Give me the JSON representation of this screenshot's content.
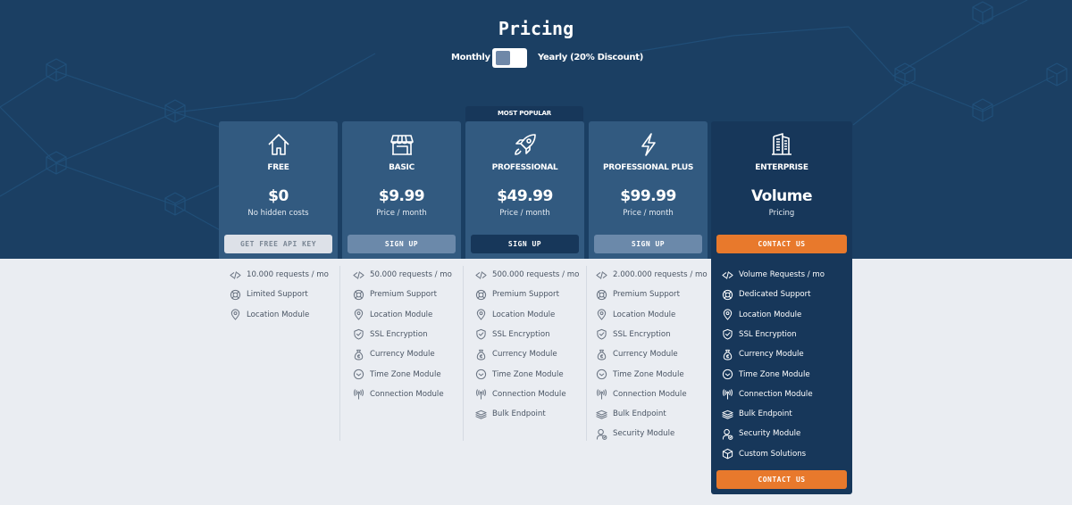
{
  "header": {
    "title": "Pricing",
    "toggle": {
      "left_label": "Monthly",
      "right_label": "Yearly  (20% Discount)",
      "selected": "Monthly"
    }
  },
  "badge": "MOST POPULAR",
  "colors": {
    "hero_bg": "#1b3f63",
    "card_bg": "#325a80",
    "enterprise_bg": "#17375a",
    "accent_orange": "#e8792c",
    "page_bg": "#eaedf2"
  },
  "plans": [
    {
      "name": "FREE",
      "icon": "house-icon",
      "price": "$0",
      "price_sub": "No hidden costs",
      "button": "GET FREE API KEY",
      "features": [
        {
          "icon": "code-icon",
          "label": "10.000 requests / mo"
        },
        {
          "icon": "lifebuoy-icon",
          "label": "Limited Support"
        },
        {
          "icon": "map-pin-icon",
          "label": "Location Module"
        }
      ]
    },
    {
      "name": "BASIC",
      "icon": "storefront-icon",
      "price": "$9.99",
      "price_sub": "Price / month",
      "button": "SIGN UP",
      "features": [
        {
          "icon": "code-icon",
          "label": "50.000 requests / mo"
        },
        {
          "icon": "lifebuoy-icon",
          "label": "Premium Support"
        },
        {
          "icon": "map-pin-icon",
          "label": "Location Module"
        },
        {
          "icon": "shield-check-icon",
          "label": "SSL Encryption"
        },
        {
          "icon": "money-bag-icon",
          "label": "Currency Module"
        },
        {
          "icon": "clock-icon",
          "label": "Time Zone Module"
        },
        {
          "icon": "antenna-icon",
          "label": "Connection Module"
        }
      ]
    },
    {
      "name": "PROFESSIONAL",
      "icon": "rocket-icon",
      "price": "$49.99",
      "price_sub": "Price / month",
      "button": "SIGN UP",
      "features": [
        {
          "icon": "code-icon",
          "label": "500.000 requests / mo"
        },
        {
          "icon": "lifebuoy-icon",
          "label": "Premium Support"
        },
        {
          "icon": "map-pin-icon",
          "label": "Location Module"
        },
        {
          "icon": "shield-check-icon",
          "label": "SSL Encryption"
        },
        {
          "icon": "money-bag-icon",
          "label": "Currency Module"
        },
        {
          "icon": "clock-icon",
          "label": "Time Zone Module"
        },
        {
          "icon": "antenna-icon",
          "label": "Connection Module"
        },
        {
          "icon": "layers-icon",
          "label": "Bulk Endpoint"
        }
      ]
    },
    {
      "name": "PROFESSIONAL PLUS",
      "icon": "lightning-icon",
      "price": "$99.99",
      "price_sub": "Price / month",
      "button": "SIGN UP",
      "features": [
        {
          "icon": "code-icon",
          "label": "2.000.000 requests / mo"
        },
        {
          "icon": "lifebuoy-icon",
          "label": "Premium Support"
        },
        {
          "icon": "map-pin-icon",
          "label": "Location Module"
        },
        {
          "icon": "shield-check-icon",
          "label": "SSL Encryption"
        },
        {
          "icon": "money-bag-icon",
          "label": "Currency Module"
        },
        {
          "icon": "clock-icon",
          "label": "Time Zone Module"
        },
        {
          "icon": "antenna-icon",
          "label": "Connection Module"
        },
        {
          "icon": "layers-icon",
          "label": "Bulk Endpoint"
        },
        {
          "icon": "user-lock-icon",
          "label": "Security Module"
        }
      ]
    },
    {
      "name": "ENTERPRISE",
      "icon": "building-icon",
      "price": "Volume",
      "price_sub": "Pricing",
      "button": "CONTACT US",
      "bottom_button": "CONTACT US",
      "features": [
        {
          "icon": "code-icon",
          "label": "Volume Requests / mo"
        },
        {
          "icon": "lifebuoy-icon",
          "label": "Dedicated Support"
        },
        {
          "icon": "map-pin-icon",
          "label": "Location Module"
        },
        {
          "icon": "shield-check-icon",
          "label": "SSL Encryption"
        },
        {
          "icon": "money-bag-icon",
          "label": "Currency Module"
        },
        {
          "icon": "clock-icon",
          "label": "Time Zone Module"
        },
        {
          "icon": "antenna-icon",
          "label": "Connection Module"
        },
        {
          "icon": "layers-icon",
          "label": "Bulk Endpoint"
        },
        {
          "icon": "user-lock-icon",
          "label": "Security Module"
        },
        {
          "icon": "cube-icon",
          "label": "Custom Solutions"
        }
      ]
    }
  ]
}
